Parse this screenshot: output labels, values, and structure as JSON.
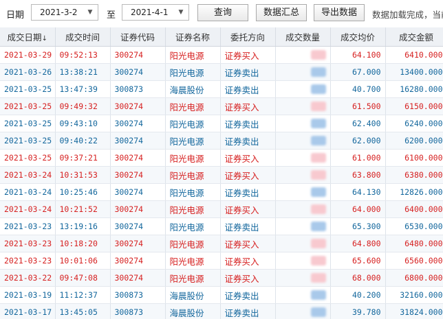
{
  "toolbar": {
    "date_label": "日期",
    "start_date": "2021-3-2",
    "to_label": "至",
    "end_date": "2021-4-1",
    "query_button": "查询",
    "summary_button": "数据汇总",
    "export_button": "导出数据",
    "status_text": "数据加载完成，当前"
  },
  "table": {
    "columns": [
      "成交日期",
      "成交时间",
      "证券代码",
      "证券名称",
      "委托方向",
      "成交数量",
      "成交均价",
      "成交金额"
    ],
    "sort_indicator": "↓",
    "rows": [
      {
        "date": "2021-03-29",
        "time": "09:52:13",
        "code": "300274",
        "name": "阳光电源",
        "direction": "证券买入",
        "price": "64.100",
        "amount": "6410.000",
        "side": "buy"
      },
      {
        "date": "2021-03-26",
        "time": "13:38:21",
        "code": "300274",
        "name": "阳光电源",
        "direction": "证券卖出",
        "price": "67.000",
        "amount": "13400.000",
        "side": "sell"
      },
      {
        "date": "2021-03-25",
        "time": "13:47:39",
        "code": "300873",
        "name": "海晨股份",
        "direction": "证券卖出",
        "price": "40.700",
        "amount": "16280.000",
        "side": "sell"
      },
      {
        "date": "2021-03-25",
        "time": "09:49:32",
        "code": "300274",
        "name": "阳光电源",
        "direction": "证券买入",
        "price": "61.500",
        "amount": "6150.000",
        "side": "buy"
      },
      {
        "date": "2021-03-25",
        "time": "09:43:10",
        "code": "300274",
        "name": "阳光电源",
        "direction": "证券卖出",
        "price": "62.400",
        "amount": "6240.000",
        "side": "sell"
      },
      {
        "date": "2021-03-25",
        "time": "09:40:22",
        "code": "300274",
        "name": "阳光电源",
        "direction": "证券卖出",
        "price": "62.000",
        "amount": "6200.000",
        "side": "sell"
      },
      {
        "date": "2021-03-25",
        "time": "09:37:21",
        "code": "300274",
        "name": "阳光电源",
        "direction": "证券买入",
        "price": "61.000",
        "amount": "6100.000",
        "side": "buy"
      },
      {
        "date": "2021-03-24",
        "time": "10:31:53",
        "code": "300274",
        "name": "阳光电源",
        "direction": "证券买入",
        "price": "63.800",
        "amount": "6380.000",
        "side": "buy"
      },
      {
        "date": "2021-03-24",
        "time": "10:25:46",
        "code": "300274",
        "name": "阳光电源",
        "direction": "证券卖出",
        "price": "64.130",
        "amount": "12826.000",
        "side": "sell"
      },
      {
        "date": "2021-03-24",
        "time": "10:21:52",
        "code": "300274",
        "name": "阳光电源",
        "direction": "证券买入",
        "price": "64.000",
        "amount": "6400.000",
        "side": "buy"
      },
      {
        "date": "2021-03-23",
        "time": "13:19:16",
        "code": "300274",
        "name": "阳光电源",
        "direction": "证券卖出",
        "price": "65.300",
        "amount": "6530.000",
        "side": "sell"
      },
      {
        "date": "2021-03-23",
        "time": "10:18:20",
        "code": "300274",
        "name": "阳光电源",
        "direction": "证券买入",
        "price": "64.800",
        "amount": "6480.000",
        "side": "buy"
      },
      {
        "date": "2021-03-23",
        "time": "10:01:06",
        "code": "300274",
        "name": "阳光电源",
        "direction": "证券买入",
        "price": "65.600",
        "amount": "6560.000",
        "side": "buy"
      },
      {
        "date": "2021-03-22",
        "time": "09:47:08",
        "code": "300274",
        "name": "阳光电源",
        "direction": "证券买入",
        "price": "68.000",
        "amount": "6800.000",
        "side": "buy"
      },
      {
        "date": "2021-03-19",
        "time": "11:12:37",
        "code": "300873",
        "name": "海晨股份",
        "direction": "证券卖出",
        "price": "40.200",
        "amount": "32160.000",
        "side": "sell"
      },
      {
        "date": "2021-03-17",
        "time": "13:45:05",
        "code": "300873",
        "name": "海晨股份",
        "direction": "证券卖出",
        "price": "39.780",
        "amount": "31824.000",
        "side": "sell"
      }
    ]
  },
  "colors": {
    "buy": "#d62020",
    "sell": "#12669c",
    "header_bg": "#eef1f5"
  }
}
